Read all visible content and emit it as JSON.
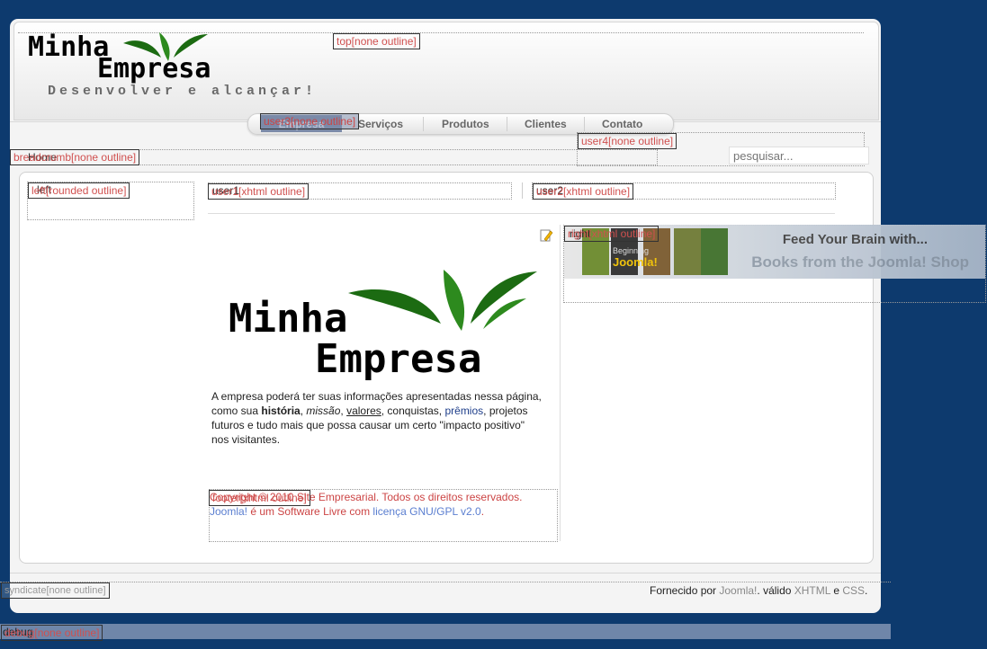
{
  "header": {
    "logo_line1": "Minha",
    "logo_line2": "Empresa",
    "slogan": "Desenvolver e alcançar!",
    "top_position_label": "top[none outline]"
  },
  "menu": {
    "items": [
      "Empresa",
      "Serviços",
      "Produtos",
      "Clientes",
      "Contato"
    ],
    "active_overlay_label": "user3[none outline]"
  },
  "positions": {
    "user4": "user4[none outline]",
    "breadcrumb": "breadcrumb[none outline]",
    "left": "left[rounded outline]",
    "user1": "user1[xhtml outline]",
    "user2": "user2[xhtml outline]",
    "right": "right[xhtml outline]",
    "footer": "footer[xhtml outline]",
    "syndicate": "syndicate[none outline]",
    "debug": "debug[none outline]"
  },
  "module_titles": {
    "left": "left",
    "user1": "user1",
    "user2": "user2",
    "right": "right",
    "debug": "debug"
  },
  "breadcrumb": {
    "home": "Home"
  },
  "search": {
    "placeholder": "pesquisar..."
  },
  "banner": {
    "line1": "Feed Your Brain with...",
    "line2": "Books from the Joomla! Shop",
    "book_title": "Joomla!",
    "book_prefix": "Beginning"
  },
  "article": {
    "logo_line1": "Minha",
    "logo_line2": "Empresa",
    "text_a": "A empresa poderá ter suas informações apresentadas nessa página, como sua ",
    "historia": "história",
    "sep1": ", ",
    "missao": "missão",
    "sep2": ", ",
    "valores": "valores",
    "text_b": ", conquistas, ",
    "premios": "prêmios",
    "text_c": ", projetos futuros e tudo mais que possa causar um certo \"impacto positivo\" nos visitantes."
  },
  "footer": {
    "copyright": "Copyright © 2010 Site Empresarial. Todos os direitos reservados.",
    "joomla": "Joomla!",
    "free_software": " é um Software Livre com ",
    "license": "licença GNU/GPL v2.0",
    "period": "."
  },
  "bottom_bar": {
    "powered": "Fornecido por ",
    "joomla": "Joomla!",
    "valid": ". válido ",
    "xhtml": "XHTML",
    "and": " e ",
    "css": "CSS",
    "end": "."
  },
  "colors": {
    "background": "#0d3a6e",
    "accent_green": "#1c6b12",
    "menu_active": "#7b8aa8",
    "position_label": "#d0504f"
  }
}
